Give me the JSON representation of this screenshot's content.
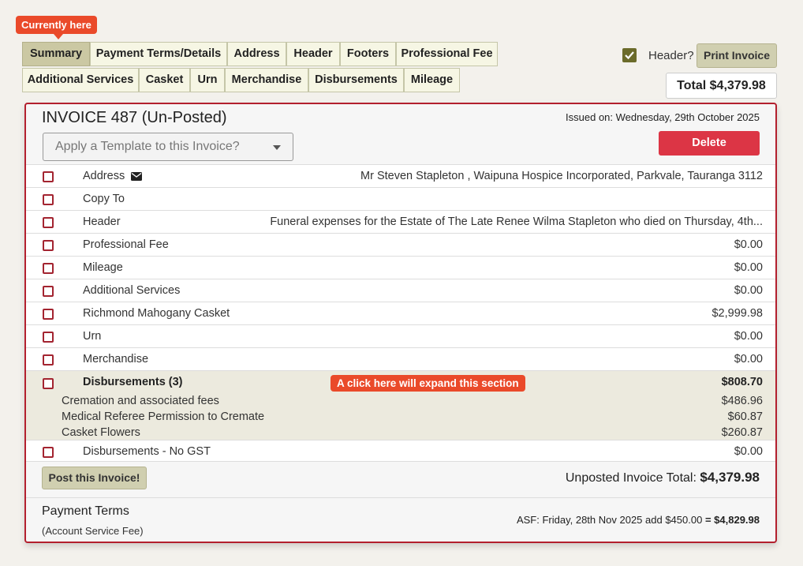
{
  "callouts": {
    "currently_here": "Currently here",
    "expand_hint": "A click here will expand this section"
  },
  "tabs_row1": [
    "Summary",
    "Payment Terms/Details",
    "Address",
    "Header",
    "Footers",
    "Professional Fee"
  ],
  "tabs_row2": [
    "Additional Services",
    "Casket",
    "Urn",
    "Merchandise",
    "Disbursements",
    "Mileage"
  ],
  "active_tab": "Summary",
  "toolbar": {
    "header_checked": true,
    "header_label": "Header?",
    "print_label": "Print Invoice",
    "total_label": "Total $4,379.98"
  },
  "invoice": {
    "title": "INVOICE 487 (Un-Posted)",
    "issued": "Issued on: Wednesday, 29th October 2025",
    "template_placeholder": "Apply a Template to this Invoice?",
    "delete_label": "Delete",
    "rows_top": [
      {
        "label": "Address",
        "value": "Mr Steven Stapleton , Waipuna Hospice Incorporated, Parkvale, Tauranga 3112",
        "icon": "envelope-icon"
      },
      {
        "label": "Copy To",
        "value": ""
      },
      {
        "label": "Header",
        "value": "Funeral expenses for the Estate of The Late Renee Wilma Stapleton who died on Thursday, 4th..."
      },
      {
        "label": "Professional Fee",
        "value": "$0.00"
      },
      {
        "label": "Mileage",
        "value": "$0.00"
      },
      {
        "label": "Additional Services",
        "value": "$0.00"
      },
      {
        "label": "Richmond Mahogany Casket",
        "value": "$2,999.98"
      },
      {
        "label": "Urn",
        "value": "$0.00"
      },
      {
        "label": "Merchandise",
        "value": "$0.00"
      }
    ],
    "disbursements": {
      "label": "Disbursements (3)",
      "value": "$808.70",
      "items": [
        {
          "label": "Cremation and associated fees",
          "value": "$486.96"
        },
        {
          "label": "Medical Referee Permission to Cremate",
          "value": "$60.87"
        },
        {
          "label": "Casket Flowers",
          "value": "$260.87"
        }
      ]
    },
    "row_no_gst": {
      "label": "Disbursements - No GST",
      "value": "$0.00"
    },
    "post_label": "Post this Invoice!",
    "unposted_label": "Unposted Invoice Total:",
    "unposted_value": "$4,379.98",
    "terms_title": "Payment Terms",
    "terms_sub": "(Account Service Fee)",
    "asf_text": "ASF: Friday, 28th Nov 2025 add $450.00",
    "asf_total": "= $4,829.98"
  }
}
